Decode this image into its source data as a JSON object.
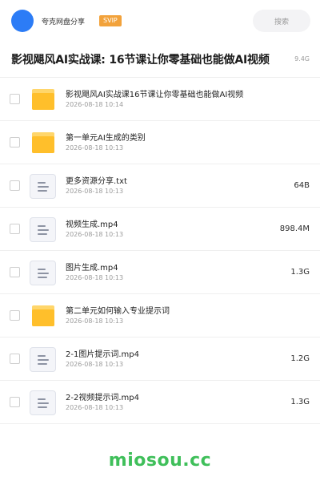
{
  "header": {
    "brand": "夸克网盘分享",
    "badge": "SVIP",
    "search_placeholder": "搜索"
  },
  "share": {
    "title": "影视飓风AI实战课: 16节课让你零基础也能做AI视频",
    "meta": "9.4G"
  },
  "files": [
    {
      "type": "folder",
      "name": "影视飓风AI实战课16节课让你零基础也能做AI视频",
      "date": "2026-08-18 10:14",
      "size": ""
    },
    {
      "type": "folder",
      "name": "第一单元AI生成的类别",
      "date": "2026-08-18 10:13",
      "size": ""
    },
    {
      "type": "file",
      "name": "更多资源分享.txt",
      "date": "2026-08-18 10:13",
      "size": "64B"
    },
    {
      "type": "file",
      "name": "视频生成.mp4",
      "date": "2026-08-18 10:13",
      "size": "898.4M"
    },
    {
      "type": "file",
      "name": "图片生成.mp4",
      "date": "2026-08-18 10:13",
      "size": "1.3G"
    },
    {
      "type": "folder",
      "name": "第二单元如何输入专业提示词",
      "date": "2026-08-18 10:13",
      "size": ""
    },
    {
      "type": "file",
      "name": "2-1图片提示词.mp4",
      "date": "2026-08-18 10:13",
      "size": "1.2G"
    },
    {
      "type": "file",
      "name": "2-2视频提示词.mp4",
      "date": "2026-08-18 10:13",
      "size": "1.3G"
    }
  ],
  "watermark": "miosou.cc",
  "colors": {
    "avatar": "#2c7cf6",
    "badge": "#f2a23b",
    "folder": "#ffbf2b",
    "watermark": "#3fbf5a"
  },
  "icons": {
    "folder": "folder-icon",
    "file": "document-icon",
    "checkbox": "checkbox-icon"
  }
}
